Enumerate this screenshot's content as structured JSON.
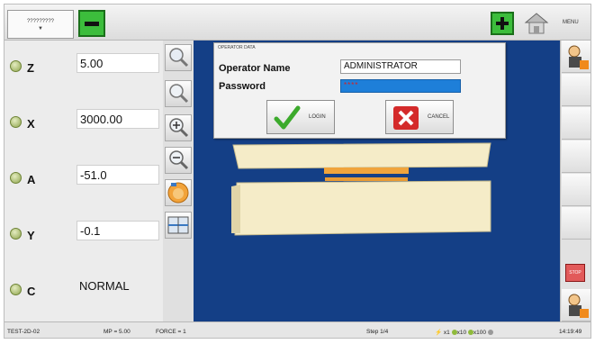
{
  "topbar": {
    "mode_select_value": "?????????",
    "menu_label": "MENU"
  },
  "axes": [
    {
      "name": "Z",
      "value": "5.00"
    },
    {
      "name": "X",
      "value": "3000.00"
    },
    {
      "name": "A",
      "value": "-51.0"
    },
    {
      "name": "Y",
      "value": "-0.1"
    },
    {
      "name": "C",
      "value": "NORMAL"
    }
  ],
  "dialog": {
    "title": "OPERATOR DATA",
    "operator_label": "Operator Name",
    "operator_value": "ADMINISTRATOR",
    "password_label": "Password",
    "password_value": "****",
    "login_label": "LOGIN",
    "cancel_label": "CANCEL"
  },
  "right": {
    "stop_label": "STOP"
  },
  "status": {
    "program": "TEST-2D-02",
    "mp": "MP = 5.00",
    "force": "FORCE = 1",
    "step": "Step 1/4",
    "x1": "x1",
    "x10": "x10",
    "x100": "x100",
    "time": "14:19:49"
  },
  "colors": {
    "workspace_bg": "#143f86",
    "accent_green": "#3cbd3c",
    "password_bg": "#1e7fd9"
  }
}
